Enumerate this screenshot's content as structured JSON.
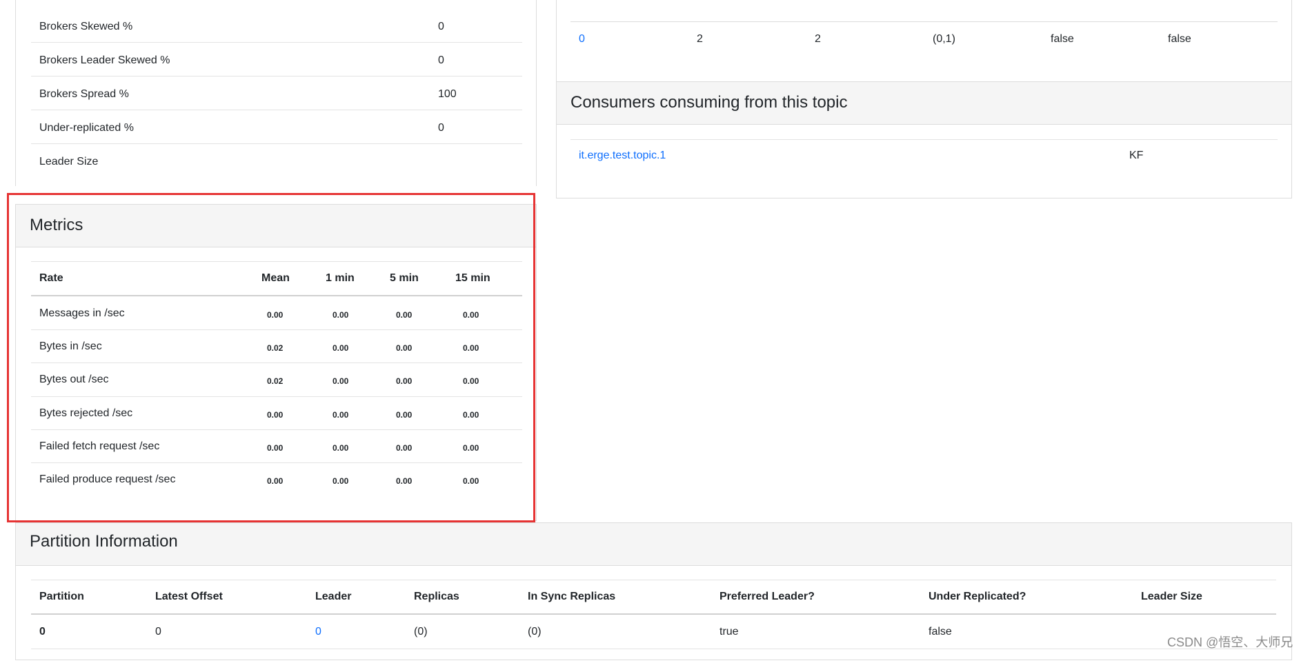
{
  "left_summary": {
    "rows": [
      {
        "label": "Brokers Skewed %",
        "value": "0"
      },
      {
        "label": "Brokers Leader Skewed %",
        "value": "0"
      },
      {
        "label": "Brokers Spread %",
        "value": "100"
      },
      {
        "label": "Under-replicated %",
        "value": "0"
      },
      {
        "label": "Leader Size",
        "value": ""
      }
    ]
  },
  "brokers_table": {
    "row": {
      "broker": "0",
      "partitions": "2",
      "leader": "2",
      "partition_list": "(0,1)",
      "skewed": "false",
      "leader_skewed": "false"
    }
  },
  "consumers": {
    "title": "Consumers consuming from this topic",
    "rows": [
      {
        "group": "it.erge.test.topic.1",
        "type": "KF"
      }
    ]
  },
  "metrics": {
    "title": "Metrics",
    "headers": [
      "Rate",
      "Mean",
      "1 min",
      "5 min",
      "15 min"
    ],
    "rows": [
      {
        "label": "Messages in /sec",
        "mean": "0.00",
        "m1": "0.00",
        "m5": "0.00",
        "m15": "0.00"
      },
      {
        "label": "Bytes in /sec",
        "mean": "0.02",
        "m1": "0.00",
        "m5": "0.00",
        "m15": "0.00"
      },
      {
        "label": "Bytes out /sec",
        "mean": "0.02",
        "m1": "0.00",
        "m5": "0.00",
        "m15": "0.00"
      },
      {
        "label": "Bytes rejected /sec",
        "mean": "0.00",
        "m1": "0.00",
        "m5": "0.00",
        "m15": "0.00"
      },
      {
        "label": "Failed fetch request /sec",
        "mean": "0.00",
        "m1": "0.00",
        "m5": "0.00",
        "m15": "0.00"
      },
      {
        "label": "Failed produce request /sec",
        "mean": "0.00",
        "m1": "0.00",
        "m5": "0.00",
        "m15": "0.00"
      }
    ]
  },
  "partition_info": {
    "title": "Partition Information",
    "headers": [
      "Partition",
      "Latest Offset",
      "Leader",
      "Replicas",
      "In Sync Replicas",
      "Preferred Leader?",
      "Under Replicated?",
      "Leader Size"
    ],
    "rows": [
      {
        "partition": "0",
        "latest_offset": "0",
        "leader": "0",
        "replicas": "(0)",
        "isr": "(0)",
        "preferred": "true",
        "under_replicated": "false",
        "leader_size": ""
      }
    ]
  },
  "watermark": "CSDN @悟空、大师兄",
  "colors": {
    "link": "#0d6efd",
    "highlight": "#e63333",
    "panel_head_bg": "#f5f5f5"
  }
}
